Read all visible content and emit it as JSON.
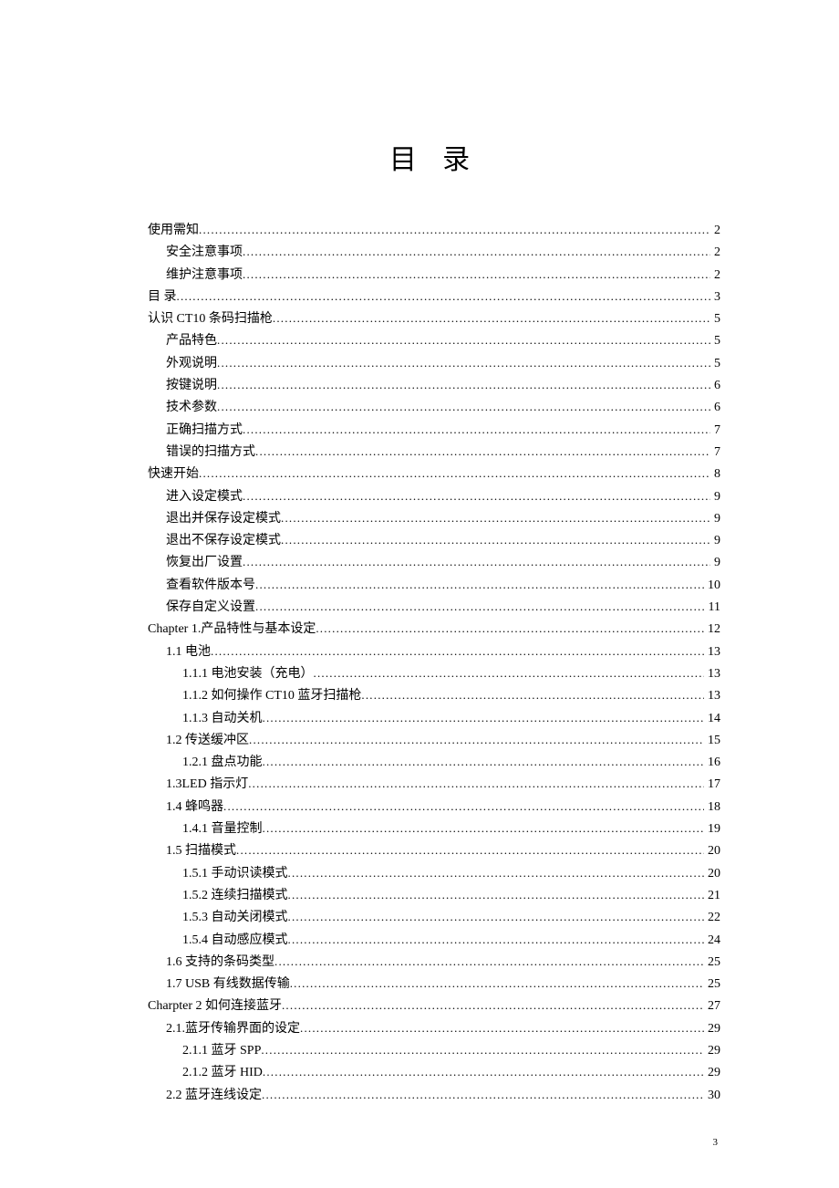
{
  "title": "目 录",
  "page_number": "3",
  "entries": [
    {
      "label": "使用需知",
      "page": "2",
      "level": 0
    },
    {
      "label": "安全注意事项",
      "page": "2",
      "level": 1
    },
    {
      "label": "维护注意事项",
      "page": "2",
      "level": 1
    },
    {
      "label": "目 录",
      "page": "3",
      "level": 0
    },
    {
      "label": "认识 CT10 条码扫描枪",
      "page": "5",
      "level": 0
    },
    {
      "label": "产品特色",
      "page": "5",
      "level": 1
    },
    {
      "label": "外观说明",
      "page": "5",
      "level": 1
    },
    {
      "label": "按键说明",
      "page": "6",
      "level": 1
    },
    {
      "label": "技术参数",
      "page": "6",
      "level": 1
    },
    {
      "label": "正确扫描方式",
      "page": "7",
      "level": 1
    },
    {
      "label": "错误的扫描方式",
      "page": "7",
      "level": 1
    },
    {
      "label": "快速开始",
      "page": "8",
      "level": 0
    },
    {
      "label": "进入设定模式",
      "page": "9",
      "level": 1
    },
    {
      "label": "退出并保存设定模式",
      "page": "9",
      "level": 1
    },
    {
      "label": "退出不保存设定模式",
      "page": "9",
      "level": 1
    },
    {
      "label": "恢复出厂设置",
      "page": "9",
      "level": 1
    },
    {
      "label": "查看软件版本号",
      "page": "10",
      "level": 1
    },
    {
      "label": "保存自定义设置",
      "page": "11",
      "level": 1
    },
    {
      "label": "Chapter 1.产品特性与基本设定",
      "page": "12",
      "level": 0
    },
    {
      "label": "1.1 电池",
      "page": "13",
      "level": 1
    },
    {
      "label": "1.1.1 电池安装（充电）",
      "page": "13",
      "level": 2
    },
    {
      "label": "1.1.2 如何操作 CT10 蓝牙扫描枪",
      "page": "13",
      "level": 2
    },
    {
      "label": "1.1.3 自动关机",
      "page": "14",
      "level": 2
    },
    {
      "label": "1.2 传送缓冲区",
      "page": "15",
      "level": 1
    },
    {
      "label": "1.2.1 盘点功能",
      "page": "16",
      "level": 2
    },
    {
      "label": "1.3LED 指示灯",
      "page": "17",
      "level": 1
    },
    {
      "label": "1.4 蜂鸣器",
      "page": "18",
      "level": 1
    },
    {
      "label": "1.4.1 音量控制",
      "page": "19",
      "level": 2
    },
    {
      "label": "1.5 扫描模式",
      "page": "20",
      "level": 1
    },
    {
      "label": "1.5.1 手动识读模式",
      "page": "20",
      "level": 2
    },
    {
      "label": "1.5.2 连续扫描模式",
      "page": "21",
      "level": 2
    },
    {
      "label": "1.5.3 自动关闭模式",
      "page": "22",
      "level": 2
    },
    {
      "label": "1.5.4 自动感应模式",
      "page": "24",
      "level": 2
    },
    {
      "label": "1.6 支持的条码类型",
      "page": "25",
      "level": 1
    },
    {
      "label": "1.7 USB 有线数据传输",
      "page": "25",
      "level": 1
    },
    {
      "label": "Charpter 2  如何连接蓝牙",
      "page": "27",
      "level": 0
    },
    {
      "label": "2.1.蓝牙传输界面的设定",
      "page": "29",
      "level": 1
    },
    {
      "label": "2.1.1 蓝牙 SPP",
      "page": "29",
      "level": 2
    },
    {
      "label": "2.1.2 蓝牙 HID",
      "page": "29",
      "level": 2
    },
    {
      "label": "2.2 蓝牙连线设定",
      "page": "30",
      "level": 1
    }
  ]
}
